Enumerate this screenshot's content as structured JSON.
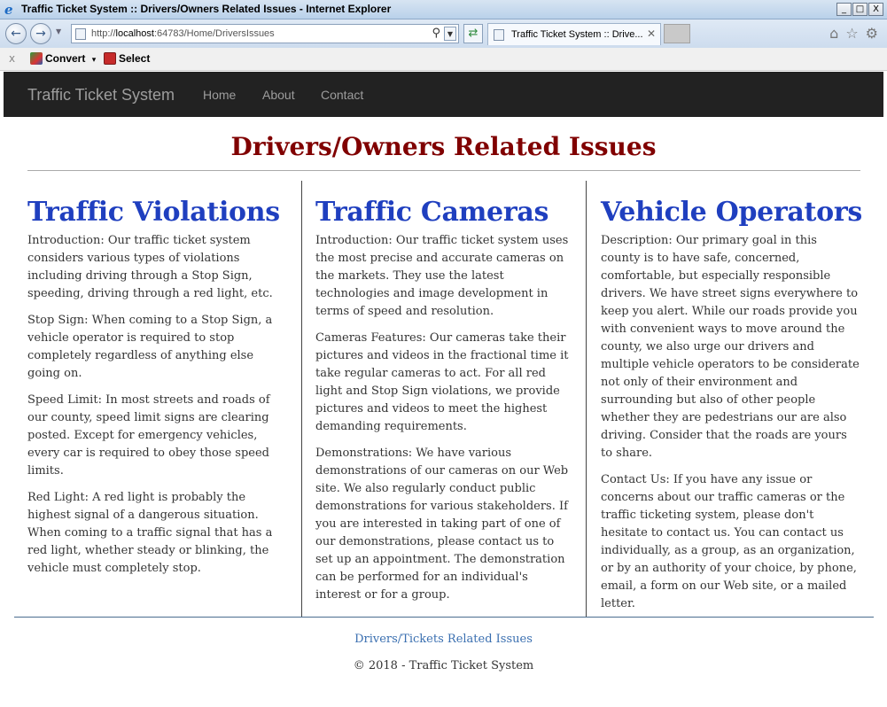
{
  "window": {
    "title": "Traffic Ticket System :: Drivers/Owners Related Issues - Internet Explorer",
    "minimize": "_",
    "maximize": "□",
    "close": "X"
  },
  "browser": {
    "url_prefix": "http://",
    "url_host": "localhost",
    "url_rest": ":64783/Home/DriversIssues",
    "tab_label": "Traffic Ticket System :: Drive...",
    "tab_close": "✕",
    "back_icon": "back-arrow-icon",
    "forward_icon": "forward-arrow-icon"
  },
  "command_bar": {
    "close": "x",
    "convert_label": "Convert",
    "convert_arrow": "▾",
    "select_label": "Select"
  },
  "site_nav": {
    "brand": "Traffic Ticket System",
    "links": [
      "Home",
      "About",
      "Contact"
    ]
  },
  "page": {
    "heading": "Drivers/Owners Related Issues",
    "columns": [
      {
        "title": "Traffic Violations",
        "paragraphs": [
          "Introduction: Our traffic ticket system considers various types of violations including driving through a Stop Sign, speeding, driving through a red light, etc.",
          "Stop Sign: When coming to a Stop Sign, a vehicle operator is required to stop completely regardless of anything else going on.",
          "Speed Limit: In most streets and roads of our county, speed limit signs are clearing posted. Except for emergency vehicles, every car is required to obey those speed limits.",
          "Red Light: A red light is probably the highest signal of a dangerous situation. When coming to a traffic signal that has a red light, whether steady or blinking, the vehicle must completely stop."
        ]
      },
      {
        "title": "Traffic Cameras",
        "paragraphs": [
          "Introduction: Our traffic ticket system uses the most precise and accurate cameras on the markets. They use the latest technologies and image development in terms of speed and resolution.",
          "Cameras Features: Our cameras take their pictures and videos in the fractional time it take regular cameras to act. For all red light and Stop Sign violations, we provide pictures and videos to meet the highest demanding requirements.",
          "Demonstrations: We have various demonstrations of our cameras on our Web site. We also regularly conduct public demonstrations for various stakeholders. If you are interested in taking part of one of our demonstrations, please contact us to set up an appointment. The demonstration can be performed for an individual's interest or for a group."
        ]
      },
      {
        "title": "Vehicle Operators",
        "paragraphs": [
          "Description: Our primary goal in this county is to have safe, concerned, comfortable, but especially responsible drivers. We have street signs everywhere to keep you alert. While our roads provide you with convenient ways to move around the county, we also urge our drivers and multiple vehicle operators to be considerate not only of their environment and surrounding but also of other people whether they are pedestrians our are also driving. Consider that the roads are yours to share.",
          "Contact Us: If you have any issue or concerns about our traffic cameras or the traffic ticketing system, please don't hesitate to contact us. You can contact us individually, as a group, as an organization, or by an authority of your choice, by phone, email, a form on our Web site, or a mailed letter."
        ]
      }
    ],
    "footer_link": "Drivers/Tickets Related Issues",
    "footer_copy": "© 2018 - Traffic Ticket System"
  },
  "colors": {
    "heading": "#800000",
    "column_title": "#1f3fbf",
    "navbar_bg": "#222222",
    "footer_link": "#3a6fb0"
  }
}
